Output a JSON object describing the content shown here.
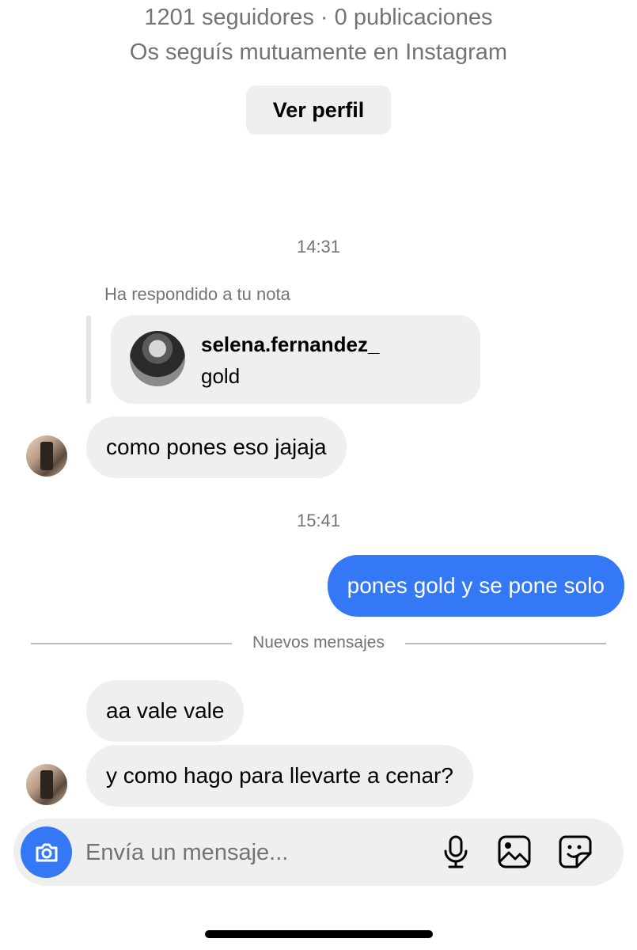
{
  "profile": {
    "stats": "1201 seguidores · 0 publicaciones",
    "mutual": "Os seguís mutuamente en Instagram",
    "view_profile_label": "Ver perfil"
  },
  "timestamps": [
    "14:31",
    "15:41"
  ],
  "note_reply": {
    "label": "Ha respondido a tu nota",
    "username": "selena.fernandez_",
    "note_text": "gold"
  },
  "messages": [
    {
      "from": "them",
      "text": "como pones eso jajaja"
    },
    {
      "from": "me",
      "text": "pones gold y se pone solo"
    },
    {
      "from": "them",
      "text": "aa vale vale"
    },
    {
      "from": "them",
      "text": "y como hago para llevarte a cenar?"
    }
  ],
  "new_messages_divider": "Nuevos mensajes",
  "composer": {
    "placeholder": "Envía un mensaje...",
    "icons": [
      "camera-icon",
      "microphone-icon",
      "gallery-icon",
      "sticker-icon"
    ]
  },
  "colors": {
    "accent": "#3478f6",
    "bubble_in": "#efefef",
    "secondary_text": "#737373"
  }
}
